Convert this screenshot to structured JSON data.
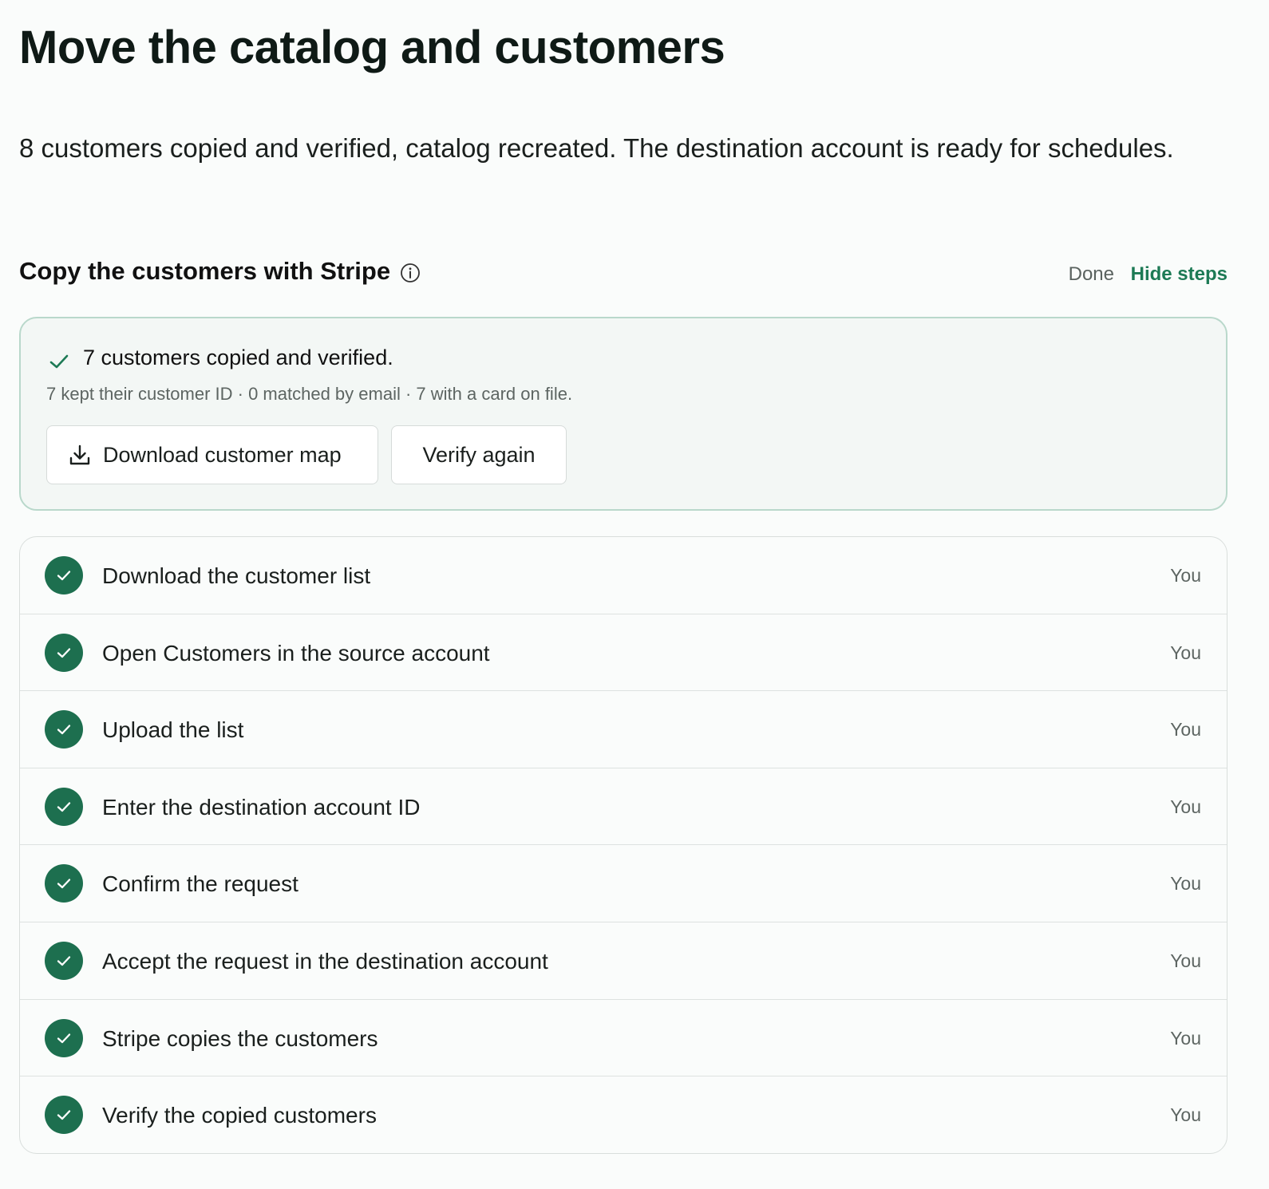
{
  "page": {
    "title": "Move the catalog and customers",
    "summary": "8 customers copied and verified, catalog recreated. The destination account is ready for schedules."
  },
  "section": {
    "title": "Copy the customers with Stripe",
    "info_icon": "info-icon",
    "status": "Done",
    "hide_steps_label": "Hide steps"
  },
  "result": {
    "icon": "check-icon",
    "title": "7 customers copied and verified.",
    "detail": "7 kept their customer ID · 0 matched by email · 7 with a card on file.",
    "download_label": "Download customer map",
    "download_icon": "download-icon",
    "verify_label": "Verify again"
  },
  "steps": [
    {
      "label": "Download the customer list",
      "owner": "You"
    },
    {
      "label": "Open Customers in the source account",
      "owner": "You"
    },
    {
      "label": "Upload the list",
      "owner": "You"
    },
    {
      "label": "Enter the destination account ID",
      "owner": "You"
    },
    {
      "label": "Confirm the request",
      "owner": "You"
    },
    {
      "label": "Accept the request in the destination account",
      "owner": "You"
    },
    {
      "label": "Stripe copies the customers",
      "owner": "You"
    },
    {
      "label": "Verify the copied customers",
      "owner": "You"
    }
  ],
  "colors": {
    "accent": "#1d7a55",
    "step_complete": "#1d6f4f",
    "result_border": "#b9d8cb"
  }
}
